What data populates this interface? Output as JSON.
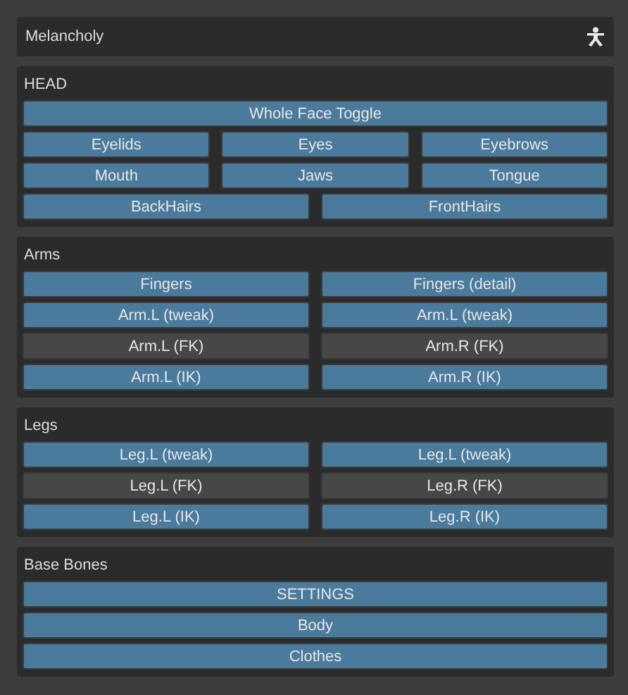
{
  "panel": {
    "title": "Melancholy"
  },
  "sections": [
    {
      "title": "HEAD",
      "rows": [
        {
          "buttons": [
            {
              "label": "Whole Face Toggle",
              "on": true
            }
          ]
        },
        {
          "buttons": [
            {
              "label": "Eyelids",
              "on": true
            },
            {
              "label": "Eyes",
              "on": true
            },
            {
              "label": "Eyebrows",
              "on": true
            }
          ]
        },
        {
          "buttons": [
            {
              "label": "Mouth",
              "on": true
            },
            {
              "label": "Jaws",
              "on": true
            },
            {
              "label": "Tongue",
              "on": true
            }
          ]
        },
        {
          "buttons": [
            {
              "label": "BackHairs",
              "on": true
            },
            {
              "label": "FrontHairs",
              "on": true
            }
          ]
        }
      ]
    },
    {
      "title": "Arms",
      "rows": [
        {
          "buttons": [
            {
              "label": "Fingers",
              "on": true
            },
            {
              "label": "Fingers (detail)",
              "on": true
            }
          ]
        },
        {
          "buttons": [
            {
              "label": "Arm.L (tweak)",
              "on": true
            },
            {
              "label": "Arm.L (tweak)",
              "on": true
            }
          ]
        },
        {
          "buttons": [
            {
              "label": "Arm.L (FK)",
              "on": false
            },
            {
              "label": "Arm.R (FK)",
              "on": false
            }
          ]
        },
        {
          "buttons": [
            {
              "label": "Arm.L (IK)",
              "on": true
            },
            {
              "label": "Arm.R (IK)",
              "on": true
            }
          ]
        }
      ]
    },
    {
      "title": "Legs",
      "rows": [
        {
          "buttons": [
            {
              "label": "Leg.L (tweak)",
              "on": true
            },
            {
              "label": "Leg.L (tweak)",
              "on": true
            }
          ]
        },
        {
          "buttons": [
            {
              "label": "Leg.L (FK)",
              "on": false
            },
            {
              "label": "Leg.R (FK)",
              "on": false
            }
          ]
        },
        {
          "buttons": [
            {
              "label": "Leg.L (IK)",
              "on": true
            },
            {
              "label": "Leg.R (IK)",
              "on": true
            }
          ]
        }
      ]
    },
    {
      "title": "Base Bones",
      "rows": [
        {
          "buttons": [
            {
              "label": "SETTINGS",
              "on": true
            }
          ]
        },
        {
          "buttons": [
            {
              "label": "Body",
              "on": true
            }
          ]
        },
        {
          "buttons": [
            {
              "label": "Clothes",
              "on": true
            }
          ]
        }
      ]
    }
  ]
}
